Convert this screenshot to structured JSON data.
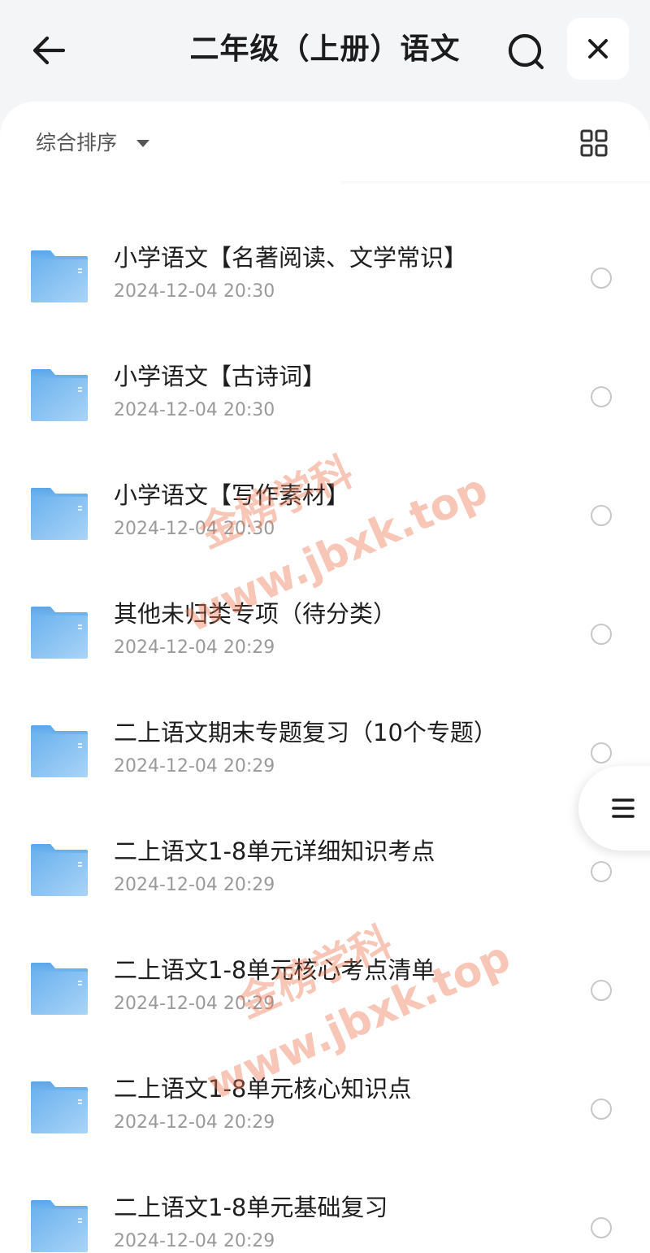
{
  "header": {
    "title": "二年级（上册）语文",
    "back_icon": "arrow-left-icon",
    "search_icon": "search-icon",
    "close_icon": "close-icon"
  },
  "toolbar": {
    "sort_label": "综合排序",
    "sort_icon": "caret-down-icon",
    "view_icon": "grid-view-icon"
  },
  "folders": [
    {
      "name": "小学语文【名著阅读、文学常识】",
      "date": "2024-12-04 20:30"
    },
    {
      "name": "小学语文【古诗词】",
      "date": "2024-12-04 20:30"
    },
    {
      "name": "小学语文【写作素材】",
      "date": "2024-12-04 20:30"
    },
    {
      "name": "其他未归类专项（待分类）",
      "date": "2024-12-04 20:29"
    },
    {
      "name": "二上语文期末专题复习（10个专题）",
      "date": "2024-12-04 20:29"
    },
    {
      "name": "二上语文1-8单元详细知识考点",
      "date": "2024-12-04 20:29"
    },
    {
      "name": "二上语文1-8单元核心考点清单",
      "date": "2024-12-04 20:29"
    },
    {
      "name": "二上语文1-8单元核心知识点",
      "date": "2024-12-04 20:29"
    },
    {
      "name": "二上语文1-8单元基础复习",
      "date": "2024-12-04 20:29"
    }
  ],
  "side_menu_icon": "menu-icon",
  "watermarks": {
    "text_cn": "金榜学科",
    "text_url": "www.jbxk.top"
  },
  "colors": {
    "background": "#f4f5f7",
    "panel": "#ffffff",
    "folder": "#7bbcf0",
    "date_text": "#9a9a9a",
    "watermark": "#ef7850"
  }
}
